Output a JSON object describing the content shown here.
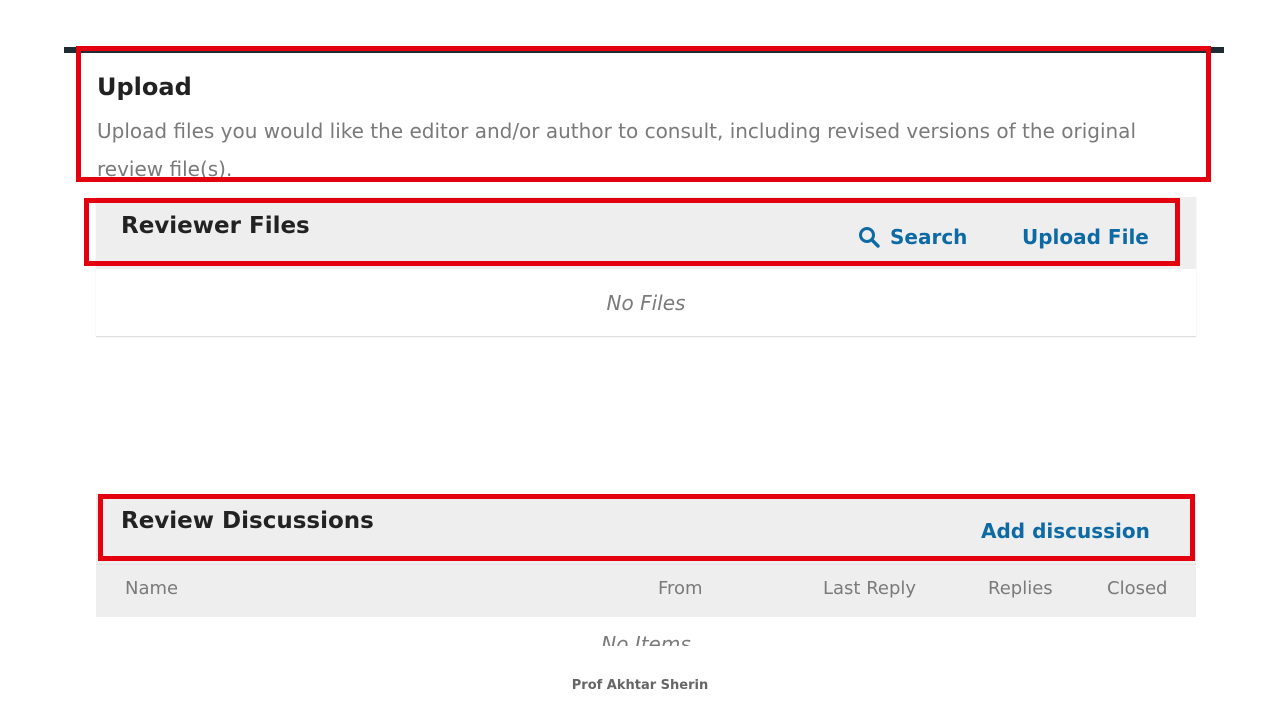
{
  "upload": {
    "title": "Upload",
    "description": "Upload files you would like the editor and/or author to consult, including revised versions of the original review file(s)."
  },
  "reviewer_files": {
    "title": "Reviewer Files",
    "search_label": "Search",
    "search_icon": "search-icon",
    "upload_label": "Upload File",
    "empty_text": "No Files"
  },
  "review_discussions": {
    "title": "Review Discussions",
    "add_label": "Add discussion",
    "columns": [
      "Name",
      "From",
      "Last Reply",
      "Replies",
      "Closed"
    ],
    "empty_text": "No Items"
  },
  "footer": {
    "text": "Prof Akhtar Sherin"
  },
  "colors": {
    "highlight": "#e3000f",
    "link": "#0d6aa5",
    "header_bg": "#eeeeee",
    "top_rule": "#1e2b33"
  }
}
